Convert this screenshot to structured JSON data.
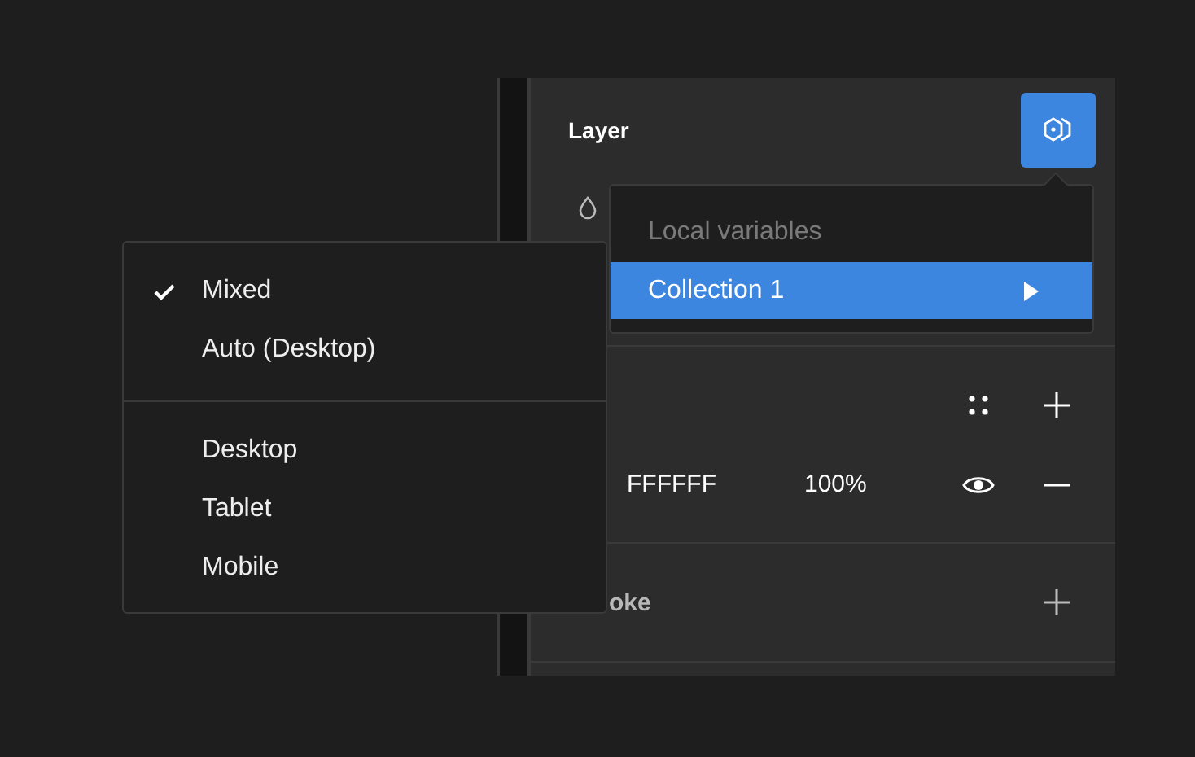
{
  "panel": {
    "title": "Layer",
    "fill": {
      "hex": "FFFFFF",
      "opacity": "100%",
      "visible": true
    },
    "stroke": {
      "label": "oke"
    }
  },
  "variables_menu": {
    "header": "Local variables",
    "items": [
      {
        "label": "Collection 1",
        "selected": true,
        "has_submenu": true
      }
    ]
  },
  "mode_menu": {
    "groups": [
      {
        "items": [
          {
            "label": "Mixed",
            "checked": true
          },
          {
            "label": "Auto (Desktop)",
            "checked": false
          }
        ]
      },
      {
        "items": [
          {
            "label": "Desktop",
            "checked": false
          },
          {
            "label": "Tablet",
            "checked": false
          },
          {
            "label": "Mobile",
            "checked": false
          }
        ]
      }
    ]
  }
}
